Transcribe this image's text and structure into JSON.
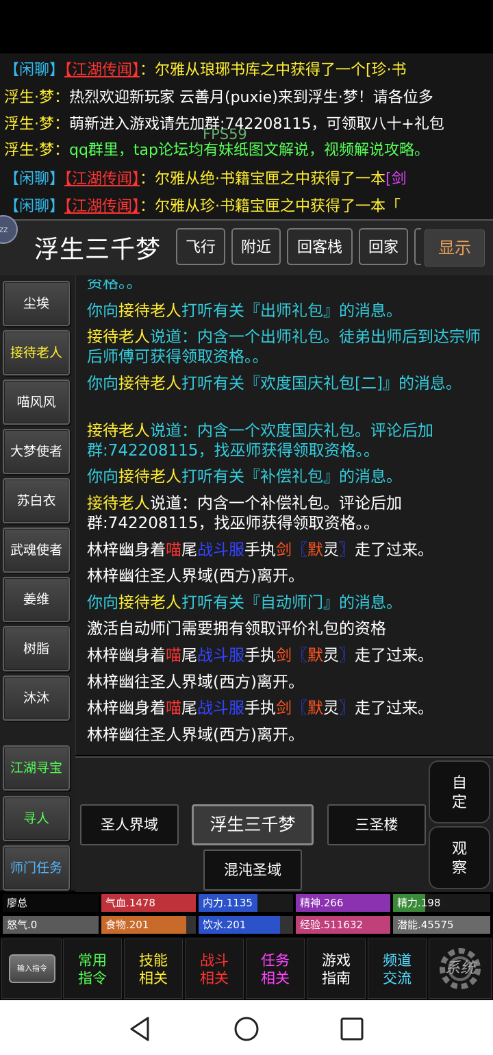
{
  "fps": "FPS59",
  "chat": {
    "lines": [
      {
        "a": "【闲聊】",
        "b": "【江湖传闻】",
        "c": "：",
        "d": "尔雅从琅琊书库之中获得了一个[珍·书"
      },
      {
        "a": "浮生·梦：",
        "b": "热烈欢迎新玩家  云善月(puxie)来到浮生·梦！请各位多"
      },
      {
        "a": "浮生·梦：",
        "b": "萌新进入游戏请先加群:742208115，可领取八十+礼包"
      },
      {
        "a": "浮生·梦：",
        "b": "qq群里，tap论坛均有妹纸图文解说，视频解说攻略。"
      },
      {
        "a": "【闲聊】",
        "b": "【江湖传闻】",
        "c": "：",
        "d": "尔雅从绝·书籍宝匣之中获得了一本",
        "e": "[剑"
      },
      {
        "a": "【闲聊】",
        "b": "【江湖传闻】",
        "c": "：",
        "d": "尔雅从珍·书籍宝匣之中获得了一本「"
      }
    ]
  },
  "header": {
    "avatar_text": "zz",
    "location": "浮生三千梦",
    "buttons": [
      "飞行",
      "附近",
      "回客栈",
      "回家"
    ],
    "show_label": "显示"
  },
  "npcs": [
    "尘埃",
    "接待老人",
    "喵风风",
    "大梦使者",
    "苏白衣",
    "武魂使者",
    "姜维",
    "树脂",
    "沐沐"
  ],
  "side_actions": [
    "江湖寻宝",
    "寻人",
    "师门任务"
  ],
  "log": {
    "l0": "资格。。",
    "l1a": "你向",
    "l1b": "接待老人",
    "l1c": "打听有关『出师礼包』的消息。",
    "l2a": "接待老人",
    "l2b": "说道：内含一个出师礼包。徒弟出师后到达宗师后师傅可获得领取资格。。",
    "l3a": "你向",
    "l3b": "接待老人",
    "l3c": "打听有关『欢度国庆礼包[二]』的消息。",
    "l4a": "接待老人",
    "l4b": "说道：内含一个欢度国庆礼包。评论后加群:742208115，找巫师获得领取资格。。",
    "l5a": "你向",
    "l5b": "接待老人",
    "l5c": "打听有关『补偿礼包』的消息。",
    "l6a": "接待老人",
    "l6b": "说道：内含一个补偿礼包。评论后加群:742208115，找巫师获得领取资格。。",
    "walk_a": "林梓幽身着",
    "walk_b": "喵",
    "walk_c": "尾",
    "walk_d": "战斗服",
    "walk_e": "手执",
    "walk_f": "剑",
    "walk_g": "〖",
    "walk_h": "默",
    "walk_i": "灵",
    "walk_j": "〗",
    "walk_k": "走了过来。",
    "leave": "林梓幽往圣人界域(西方)离开。",
    "l9a": "你向",
    "l9b": "接待老人",
    "l9c": "打听有关『自动师门』的消息。",
    "l10": "激活自动师门需要拥有领取评价礼包的资格"
  },
  "map": {
    "west": "圣人界域",
    "current": "浮生三千梦",
    "east": "三圣楼",
    "south": "混沌圣域"
  },
  "side_round": {
    "custom": "自\n定",
    "observe": "观\n察"
  },
  "stats": {
    "name": "廖总",
    "hp": "气血.1478",
    "mp": "内力.1135",
    "spirit": "精神.266",
    "energy": "精力.198",
    "rage": "怒气.0",
    "food": "食物.201",
    "water": "饮水.201",
    "exp": "经验.511632",
    "potential": "潜能.45575",
    "fills": {
      "hp": 1.0,
      "mp": 0.62,
      "spirit": 1.0,
      "energy": 0.33,
      "rage": 1.0,
      "food": 0.9,
      "water": 0.86,
      "exp": 1.0,
      "potential": 1.0
    },
    "colors": {
      "hp": "#c0323a",
      "mp": "#2b52c8",
      "spirit": "#8a32b0",
      "energy": "#3a8a3a",
      "rage": "#5a5a5a",
      "food": "#c86a2a",
      "water": "#2b52c8",
      "exp": "#c0407a",
      "potential": "#6a6a6a"
    }
  },
  "menu": {
    "input_label": "输入指令",
    "items": [
      {
        "l1": "常用",
        "l2": "指令"
      },
      {
        "l1": "技能",
        "l2": "相关"
      },
      {
        "l1": "战斗",
        "l2": "相关"
      },
      {
        "l1": "任务",
        "l2": "相关"
      },
      {
        "l1": "游戏",
        "l2": "指南"
      },
      {
        "l1": "频道",
        "l2": "交流"
      }
    ],
    "system_label": "系统"
  },
  "icons": {
    "back": "back-icon",
    "home": "home-icon",
    "recents": "recents-icon",
    "gear": "gear-icon"
  }
}
